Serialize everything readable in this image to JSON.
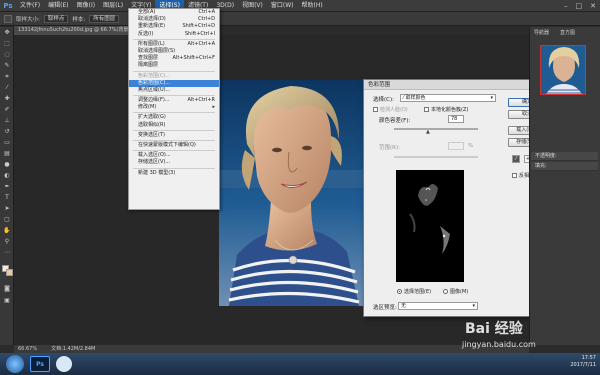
{
  "app": {
    "logo": "Ps"
  },
  "menubar": {
    "items": [
      "文件(F)",
      "编辑(E)",
      "图像(I)",
      "图层(L)",
      "文字(Y)",
      "选择(S)",
      "滤镜(T)",
      "3D(D)",
      "视图(V)",
      "窗口(W)",
      "帮助(H)"
    ],
    "active_index": 5,
    "window_controls": [
      "–",
      "□",
      "✕"
    ]
  },
  "options_bar": {
    "size_label": "取样大小:",
    "size_value": "取样点",
    "sample_label": "样本:",
    "sample_value": "所有图层"
  },
  "document": {
    "tab_title": "133142jfnnu5uch2tu200d.jpg @ 66.7%(背景 拷贝, RGB/8)"
  },
  "select_menu": {
    "items": [
      {
        "label": "全部(A)",
        "shortcut": "Ctrl+A",
        "state": "normal"
      },
      {
        "label": "取消选择(D)",
        "shortcut": "Ctrl+D",
        "state": "normal"
      },
      {
        "label": "重新选择(E)",
        "shortcut": "Shift+Ctrl+D",
        "state": "normal"
      },
      {
        "label": "反选(I)",
        "shortcut": "Shift+Ctrl+I",
        "state": "normal"
      },
      {
        "sep": true
      },
      {
        "label": "所有图层(L)",
        "shortcut": "Alt+Ctrl+A",
        "state": "normal"
      },
      {
        "label": "取消选择图层(S)",
        "shortcut": "",
        "state": "normal"
      },
      {
        "label": "查找图层",
        "shortcut": "Alt+Shift+Ctrl+F",
        "state": "normal"
      },
      {
        "label": "隔离图层",
        "shortcut": "",
        "state": "normal"
      },
      {
        "sep": true
      },
      {
        "label": "色彩范围(C)...",
        "shortcut": "",
        "state": "disabled"
      },
      {
        "label": "色彩范围(C)...",
        "shortcut": "",
        "state": "highlight"
      },
      {
        "label": "焦点区域(U)...",
        "shortcut": "",
        "state": "normal"
      },
      {
        "sep": true
      },
      {
        "label": "调整边缘(F)...",
        "shortcut": "Alt+Ctrl+R",
        "state": "normal"
      },
      {
        "label": "修改(M)",
        "shortcut": "▸",
        "state": "normal"
      },
      {
        "sep": true
      },
      {
        "label": "扩大选取(G)",
        "shortcut": "",
        "state": "normal"
      },
      {
        "label": "选取相似(R)",
        "shortcut": "",
        "state": "normal"
      },
      {
        "sep": true
      },
      {
        "label": "变换选区(T)",
        "shortcut": "",
        "state": "normal"
      },
      {
        "sep": true
      },
      {
        "label": "在快速蒙版模式下编辑(Q)",
        "shortcut": "",
        "state": "normal"
      },
      {
        "sep": true
      },
      {
        "label": "载入选区(O)...",
        "shortcut": "",
        "state": "normal"
      },
      {
        "label": "存储选区(V)...",
        "shortcut": "",
        "state": "normal"
      },
      {
        "sep": true
      },
      {
        "label": "新建 3D 模型(3)",
        "shortcut": "",
        "state": "normal"
      }
    ]
  },
  "color_range_dialog": {
    "title": "色彩范围",
    "select_label": "选择(C):",
    "select_value": "取样颜色",
    "detect_faces_label": "检测人脸(D)",
    "localized_label": "本地化颜色簇(Z)",
    "fuzziness_label": "颜色容差(F):",
    "fuzziness_value": "78",
    "range_label": "范围(R):",
    "range_unit": "%",
    "radio_selection": "选择范围(E)",
    "radio_image": "图像(M)",
    "preview_label": "选区预览:",
    "preview_value": "无",
    "ok_label": "确定",
    "cancel_label": "取消",
    "load_label": "载入(L)...",
    "save_label": "存储(S)...",
    "invert_label": "反相(I)",
    "close": "✕"
  },
  "right_panel": {
    "navigator_tab": "导航器",
    "histogram_tab": "直方图",
    "layer_rows": [
      "不透明度:",
      "填充:"
    ]
  },
  "status": {
    "zoom": "66.67%",
    "doc_info": "文档:1.42M/2.84M"
  },
  "taskbar": {
    "ps_label": "Ps",
    "time": "17:57",
    "date": "2017/7/11"
  },
  "watermark": {
    "text": "Bai 经验",
    "url": "jingyan.baidu.com"
  }
}
